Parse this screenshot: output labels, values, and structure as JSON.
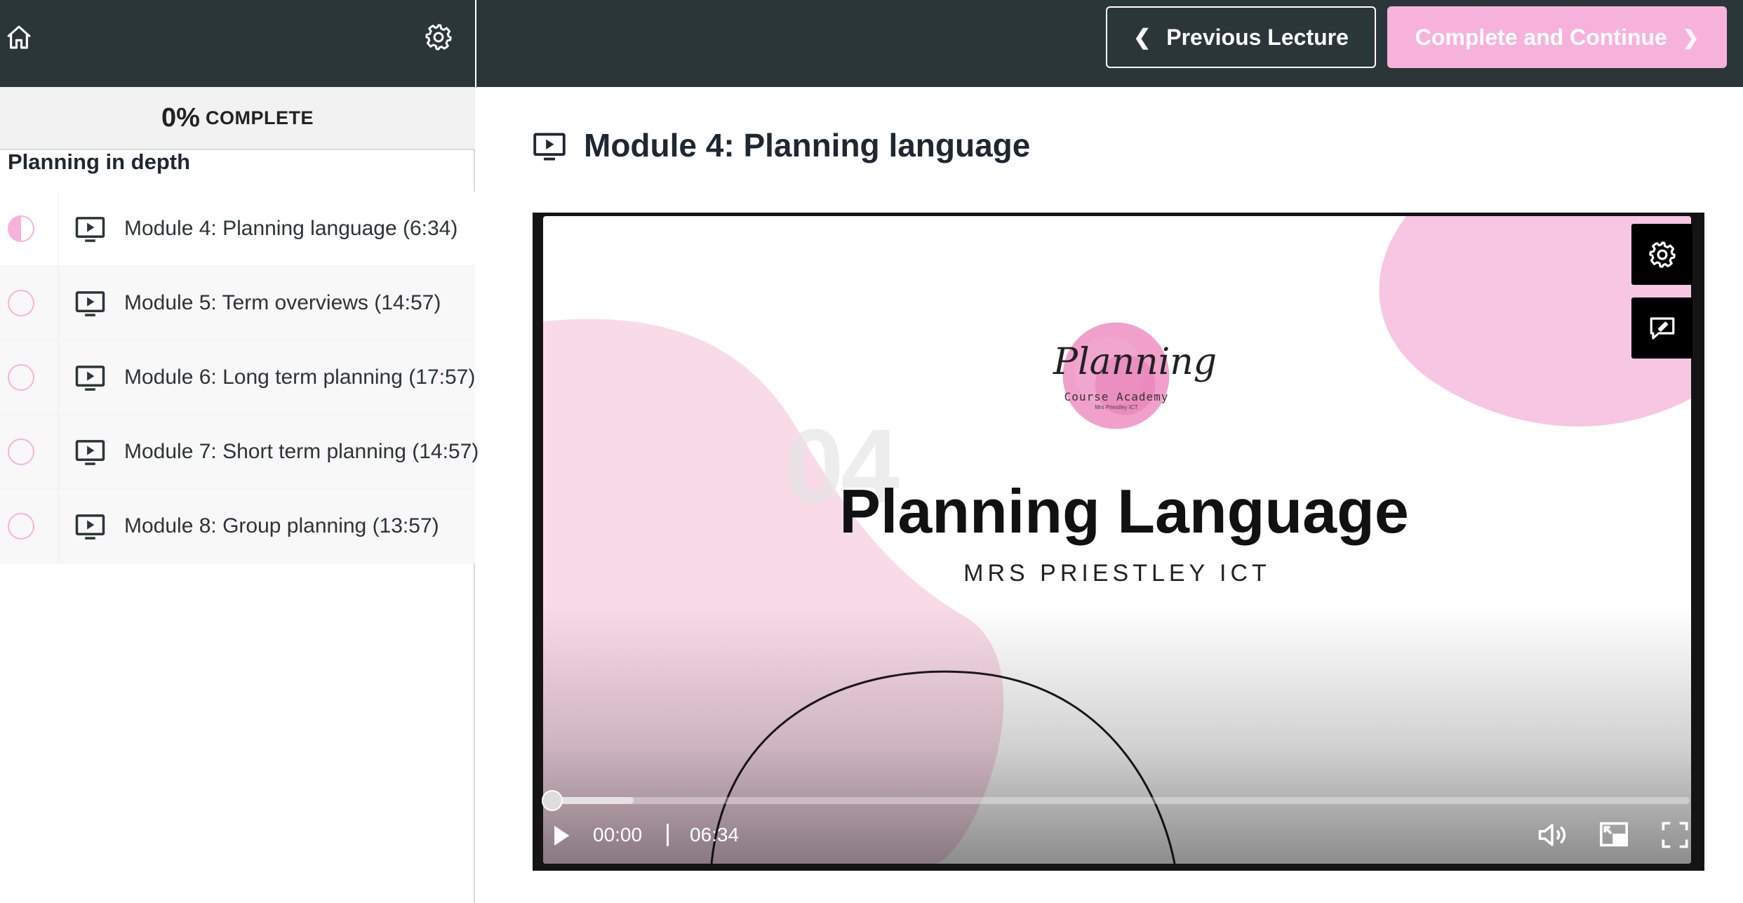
{
  "sidebar": {
    "progress": {
      "percent": "0%",
      "label": "COMPLETE"
    },
    "section_title": "Planning in depth",
    "lectures": [
      {
        "label": "Module 4: Planning language (6:34)",
        "status": "in-progress"
      },
      {
        "label": "Module 5: Term overviews (14:57)",
        "status": "not-started"
      },
      {
        "label": "Module 6: Long term planning (17:57)",
        "status": "not-started"
      },
      {
        "label": "Module 7: Short term planning (14:57)",
        "status": "not-started"
      },
      {
        "label": "Module 8: Group planning (13:57)",
        "status": "not-started"
      }
    ]
  },
  "topbar": {
    "previous_label": "Previous Lecture",
    "complete_label": "Complete and Continue"
  },
  "main": {
    "lecture_title": "Module 4: Planning language"
  },
  "video": {
    "slide": {
      "logo_script": "Planning",
      "logo_sub": "Course Academy",
      "logo_sub2": "Mrs Priestley ICT",
      "number": "04",
      "title": "Planning Language",
      "subtitle": "MRS PRIESTLEY ICT"
    },
    "current_time": "00:00",
    "duration": "06:34",
    "progress_fraction": 0
  },
  "colors": {
    "dark_bar": "#2b3638",
    "accent_pink": "#f7b2dc",
    "text_dark": "#1f2733"
  },
  "icons": [
    "home-icon",
    "gear-icon",
    "play-video-icon",
    "settings-icon",
    "feedback-icon",
    "volume-icon",
    "pip-icon",
    "fullscreen-icon",
    "chevron-left-icon",
    "chevron-right-icon"
  ]
}
